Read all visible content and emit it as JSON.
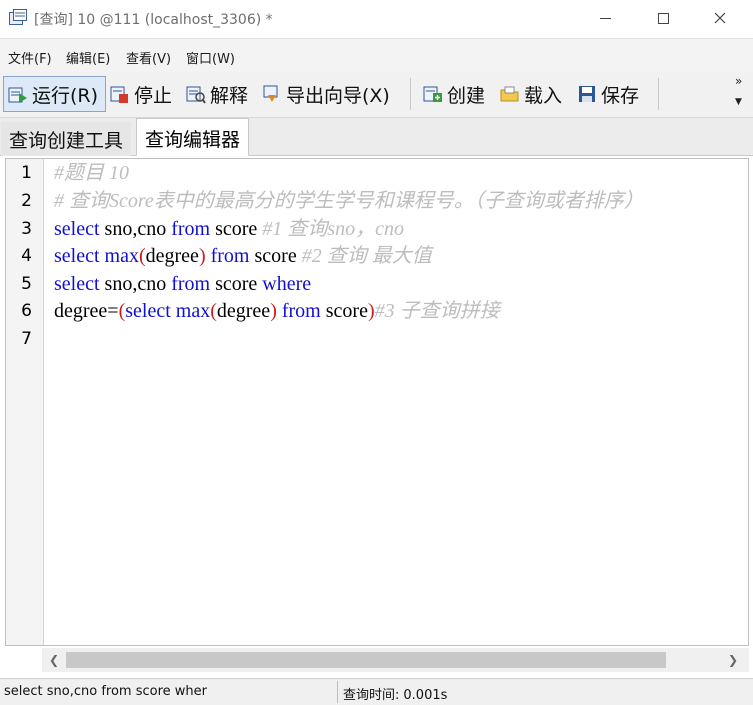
{
  "window": {
    "title": "[查询] 10 @111 (localhost_3306) *",
    "icon": "query-window-icon"
  },
  "menu": {
    "items": [
      {
        "label": "文件(F)"
      },
      {
        "label": "编辑(E)"
      },
      {
        "label": "查看(V)"
      },
      {
        "label": "窗口(W)"
      }
    ]
  },
  "toolbar": {
    "run_label": "运行(R)",
    "stop_label": "停止",
    "explain_label": "解释",
    "export_label": "导出向导(X)",
    "create_label": "创建",
    "load_label": "载入",
    "save_label": "保存",
    "more_label": "»"
  },
  "tabs": [
    {
      "label": "查询创建工具",
      "active": false
    },
    {
      "label": "查询编辑器",
      "active": true
    }
  ],
  "editor": {
    "line_numbers": [
      "1",
      "2",
      "3",
      "4",
      "5",
      "6",
      "7"
    ],
    "lines": [
      {
        "tokens": [
          {
            "t": "#题目 10",
            "c": "cmt"
          }
        ]
      },
      {
        "tokens": [
          {
            "t": "# 查询Score表中的最高分的学生学号和课程号。（子查询或者排序）",
            "c": "cmt"
          }
        ]
      },
      {
        "tokens": [
          {
            "t": "select",
            "c": "kw"
          },
          {
            "t": " sno,cno ",
            "c": "plain"
          },
          {
            "t": "from",
            "c": "kw"
          },
          {
            "t": " score ",
            "c": "plain"
          },
          {
            "t": "#1 查询sno，cno",
            "c": "cmt"
          }
        ]
      },
      {
        "tokens": [
          {
            "t": "select",
            "c": "kw"
          },
          {
            "t": " ",
            "c": "plain"
          },
          {
            "t": "max",
            "c": "fn"
          },
          {
            "t": "(",
            "c": "paren"
          },
          {
            "t": "degree",
            "c": "plain"
          },
          {
            "t": ")",
            "c": "paren"
          },
          {
            "t": " ",
            "c": "plain"
          },
          {
            "t": "from",
            "c": "kw"
          },
          {
            "t": " score ",
            "c": "plain"
          },
          {
            "t": "#2 查询 最大值",
            "c": "cmt"
          }
        ]
      },
      {
        "tokens": [
          {
            "t": "select",
            "c": "kw"
          },
          {
            "t": " sno,cno ",
            "c": "plain"
          },
          {
            "t": "from",
            "c": "kw"
          },
          {
            "t": " score ",
            "c": "plain"
          },
          {
            "t": "where",
            "c": "kw"
          }
        ]
      },
      {
        "tokens": [
          {
            "t": "degree=",
            "c": "plain"
          },
          {
            "t": "(",
            "c": "paren"
          },
          {
            "t": "select",
            "c": "kw"
          },
          {
            "t": " ",
            "c": "plain"
          },
          {
            "t": "max",
            "c": "fn"
          },
          {
            "t": "(",
            "c": "paren"
          },
          {
            "t": "degree",
            "c": "plain"
          },
          {
            "t": ")",
            "c": "paren"
          },
          {
            "t": " ",
            "c": "plain"
          },
          {
            "t": "from",
            "c": "kw"
          },
          {
            "t": " score",
            "c": "plain"
          },
          {
            "t": ")",
            "c": "paren"
          },
          {
            "t": "#3 子查询拼接",
            "c": "cmt"
          }
        ]
      },
      {
        "tokens": []
      }
    ]
  },
  "statusbar": {
    "sql_preview": "select sno,cno from score wher",
    "time_label": "查询时间:",
    "time_value": "0.001s"
  },
  "colors": {
    "keyword": "#1010d0",
    "paren": "#c81e1e",
    "comment": "#bdbdbd",
    "run_button_bg": "#dde9f6"
  }
}
